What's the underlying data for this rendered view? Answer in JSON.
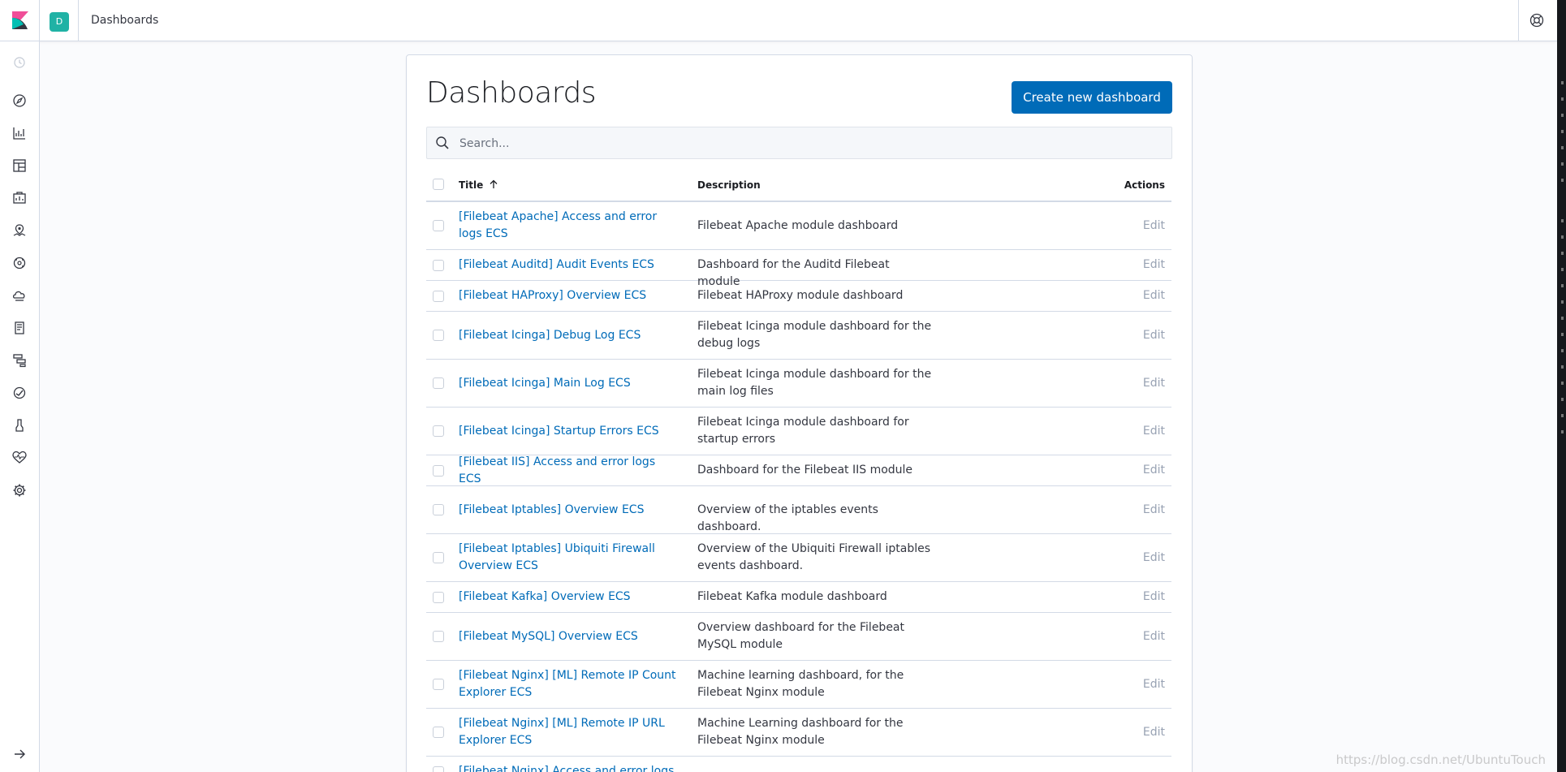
{
  "header": {
    "space_initial": "D",
    "breadcrumb": "Dashboards"
  },
  "sidenav": {
    "items": [
      {
        "icon": "recently-viewed-icon"
      },
      {
        "icon": "discover-compass-icon"
      },
      {
        "icon": "visualize-icon"
      },
      {
        "icon": "dashboard-icon"
      },
      {
        "icon": "canvas-icon"
      },
      {
        "icon": "maps-icon"
      },
      {
        "icon": "machine-learning-icon"
      },
      {
        "icon": "infrastructure-icon"
      },
      {
        "icon": "logs-icon"
      },
      {
        "icon": "apm-icon"
      },
      {
        "icon": "uptime-icon"
      },
      {
        "icon": "dev-tools-icon"
      },
      {
        "icon": "monitoring-icon"
      },
      {
        "icon": "management-gear-icon"
      },
      {
        "icon": "expand-arrow-icon"
      }
    ]
  },
  "page": {
    "title": "Dashboards",
    "create_button": "Create new dashboard",
    "search_placeholder": "Search..."
  },
  "table": {
    "columns": {
      "title": "Title",
      "description": "Description",
      "actions": "Actions"
    },
    "sort_indicator": "ascending",
    "rows": [
      {
        "title": "[Filebeat Apache] Access and error logs ECS",
        "description": "Filebeat Apache module dashboard",
        "action": "Edit"
      },
      {
        "title": "[Filebeat Auditd] Audit Events ECS",
        "description": "Dashboard for the Auditd Filebeat module",
        "action": "Edit"
      },
      {
        "title": "[Filebeat HAProxy] Overview ECS",
        "description": "Filebeat HAProxy module dashboard",
        "action": "Edit"
      },
      {
        "title": "[Filebeat Icinga] Debug Log ECS",
        "description": "Filebeat Icinga module dashboard for the debug logs",
        "action": "Edit"
      },
      {
        "title": "[Filebeat Icinga] Main Log ECS",
        "description": "Filebeat Icinga module dashboard for the main log files",
        "action": "Edit"
      },
      {
        "title": "[Filebeat Icinga] Startup Errors ECS",
        "description": "Filebeat Icinga module dashboard for startup errors",
        "action": "Edit"
      },
      {
        "title": "[Filebeat IIS] Access and error logs ECS",
        "description": "Dashboard for the Filebeat IIS module",
        "action": "Edit"
      },
      {
        "title": "[Filebeat Iptables] Overview ECS",
        "description": "Overview of the iptables events dashboard.",
        "action": "Edit"
      },
      {
        "title": "[Filebeat Iptables] Ubiquiti Firewall Overview ECS",
        "description": "Overview of the Ubiquiti Firewall iptables events dashboard.",
        "action": "Edit"
      },
      {
        "title": "[Filebeat Kafka] Overview ECS",
        "description": "Filebeat Kafka module dashboard",
        "action": "Edit"
      },
      {
        "title": "[Filebeat MySQL] Overview ECS",
        "description": "Overview dashboard for the Filebeat MySQL module",
        "action": "Edit"
      },
      {
        "title": "[Filebeat Nginx] [ML] Remote IP Count Explorer ECS",
        "description": "Machine learning dashboard, for the Filebeat Nginx module",
        "action": "Edit"
      },
      {
        "title": "[Filebeat Nginx] [ML] Remote IP URL Explorer ECS",
        "description": "Machine Learning dashboard for the Filebeat Nginx module",
        "action": "Edit"
      },
      {
        "title": "[Filebeat Nginx] Access and error logs",
        "description": "",
        "action": ""
      }
    ]
  },
  "watermark": "https://blog.csdn.net/UbuntuTouch",
  "colors": {
    "accent": "#006bb8",
    "space": "#20b2a5"
  }
}
